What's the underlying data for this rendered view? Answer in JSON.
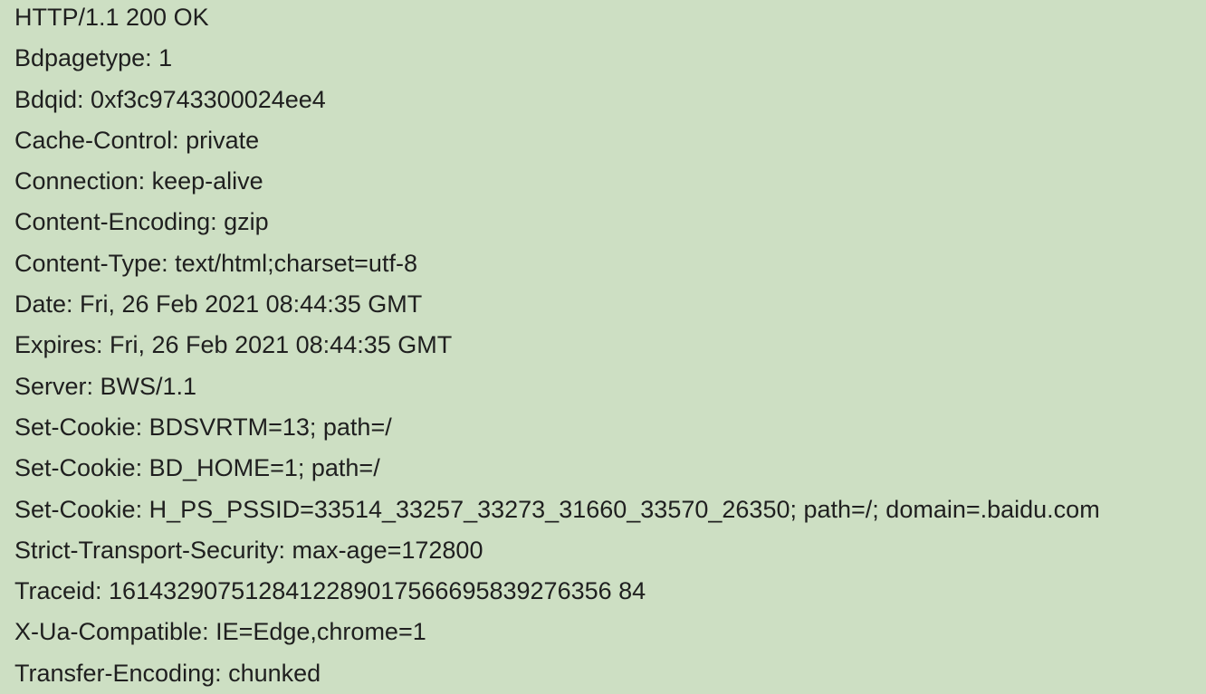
{
  "response": {
    "lines": [
      "HTTP/1.1 200 OK",
      "Bdpagetype: 1",
      "Bdqid: 0xf3c9743300024ee4",
      "Cache-Control: private",
      "Connection: keep-alive",
      "Content-Encoding: gzip",
      "Content-Type: text/html;charset=utf-8",
      "Date: Fri, 26 Feb 2021 08:44:35 GMT",
      "Expires: Fri, 26 Feb 2021 08:44:35 GMT",
      "Server: BWS/1.1",
      "Set-Cookie: BDSVRTM=13; path=/",
      "Set-Cookie: BD_HOME=1; path=/",
      "Set-Cookie: H_PS_PSSID=33514_33257_33273_31660_33570_26350; path=/; domain=.baidu.com",
      "Strict-Transport-Security: max-age=172800",
      "Traceid: 1614329075128412289017566695839276356 84",
      "X-Ua-Compatible: IE=Edge,chrome=1",
      "Transfer-Encoding: chunked"
    ]
  },
  "colors": {
    "background": "#cddfc3",
    "text": "#1f1f1f"
  }
}
